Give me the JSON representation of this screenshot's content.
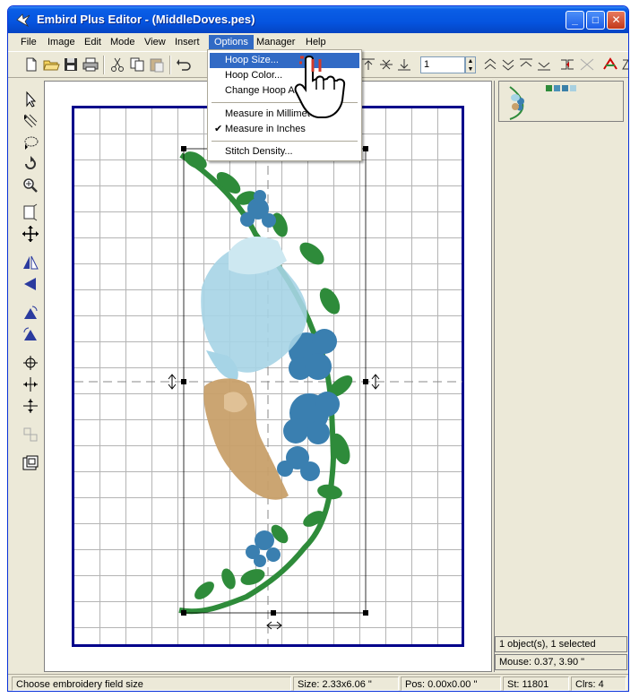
{
  "window": {
    "title": "Embird Plus Editor - (MiddleDoves.pes)"
  },
  "menu": [
    "File",
    "Image",
    "Edit",
    "Mode",
    "View",
    "Insert",
    "Options",
    "Manager",
    "Help"
  ],
  "options_menu": {
    "items": [
      {
        "label": "Hoop Size...",
        "highlighted": true,
        "checked": false
      },
      {
        "label": "Hoop Color...",
        "highlighted": false,
        "checked": false
      },
      {
        "label": "Change Hoop A",
        "highlighted": false,
        "checked": false
      },
      {
        "label": "Measure in Millimet",
        "highlighted": false,
        "checked": false
      },
      {
        "label": "Measure in Inches",
        "highlighted": false,
        "checked": true
      },
      {
        "label": "Stitch Density...",
        "highlighted": false,
        "checked": false
      }
    ],
    "check_glyph": "✔"
  },
  "toolbar": {
    "stitch_value": "1"
  },
  "right_panel": {
    "swatch_colors": [
      "#2e8b3a",
      "#4a90b8",
      "#3a7fa8",
      "#a8d0e0"
    ],
    "selection_info": "1 object(s), 1 selected",
    "mouse_info": "Mouse: 0.37, 3.90 \""
  },
  "status": {
    "message": "Choose embroidery field size",
    "size": "Size: 2.33x6.06 \"",
    "pos": "Pos: 0.00x0.00 \"",
    "stitches": "St: 11801",
    "colors": "Clrs: 4"
  },
  "design_colors": {
    "green": "#2e8b3a",
    "blue": "#3a7fb0",
    "lightblue": "#a6d4e6",
    "tan": "#c8a06a",
    "hoop": "#00008b"
  },
  "icons": [
    "embird-logo-icon",
    "minimize-icon",
    "maximize-icon",
    "close-icon",
    "hand-pointer-icon"
  ]
}
